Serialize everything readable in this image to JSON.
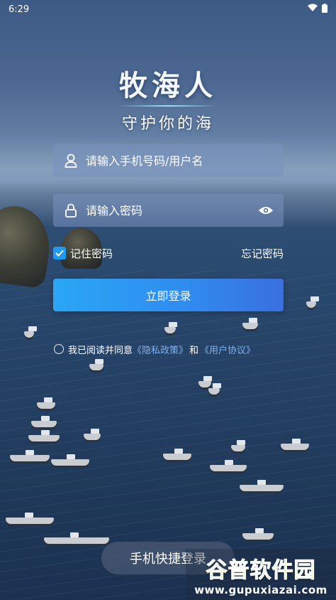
{
  "status_bar": {
    "time": "6:29"
  },
  "logo": {
    "title": "牧海人",
    "slogan": "守护你的海"
  },
  "login_form": {
    "username_placeholder": "请输入手机号码/用户名",
    "password_placeholder": "请输入密码",
    "remember_label": "记住密码",
    "remember_checked": true,
    "forgot_label": "忘记密码",
    "login_button": "立即登录"
  },
  "agreement": {
    "prefix": "我已阅读并同意",
    "privacy_link": "《隐私政策》",
    "and": "和",
    "terms_link": "《用户协议》",
    "link_color": "#7fb0f2"
  },
  "quick_login": {
    "label": "手机快捷登录"
  },
  "watermark": {
    "title": "谷普软件园",
    "url": "www.gupuxiazai.com"
  },
  "colors": {
    "accent": "#2f8df0",
    "checkbox": "#1e9bf0"
  }
}
